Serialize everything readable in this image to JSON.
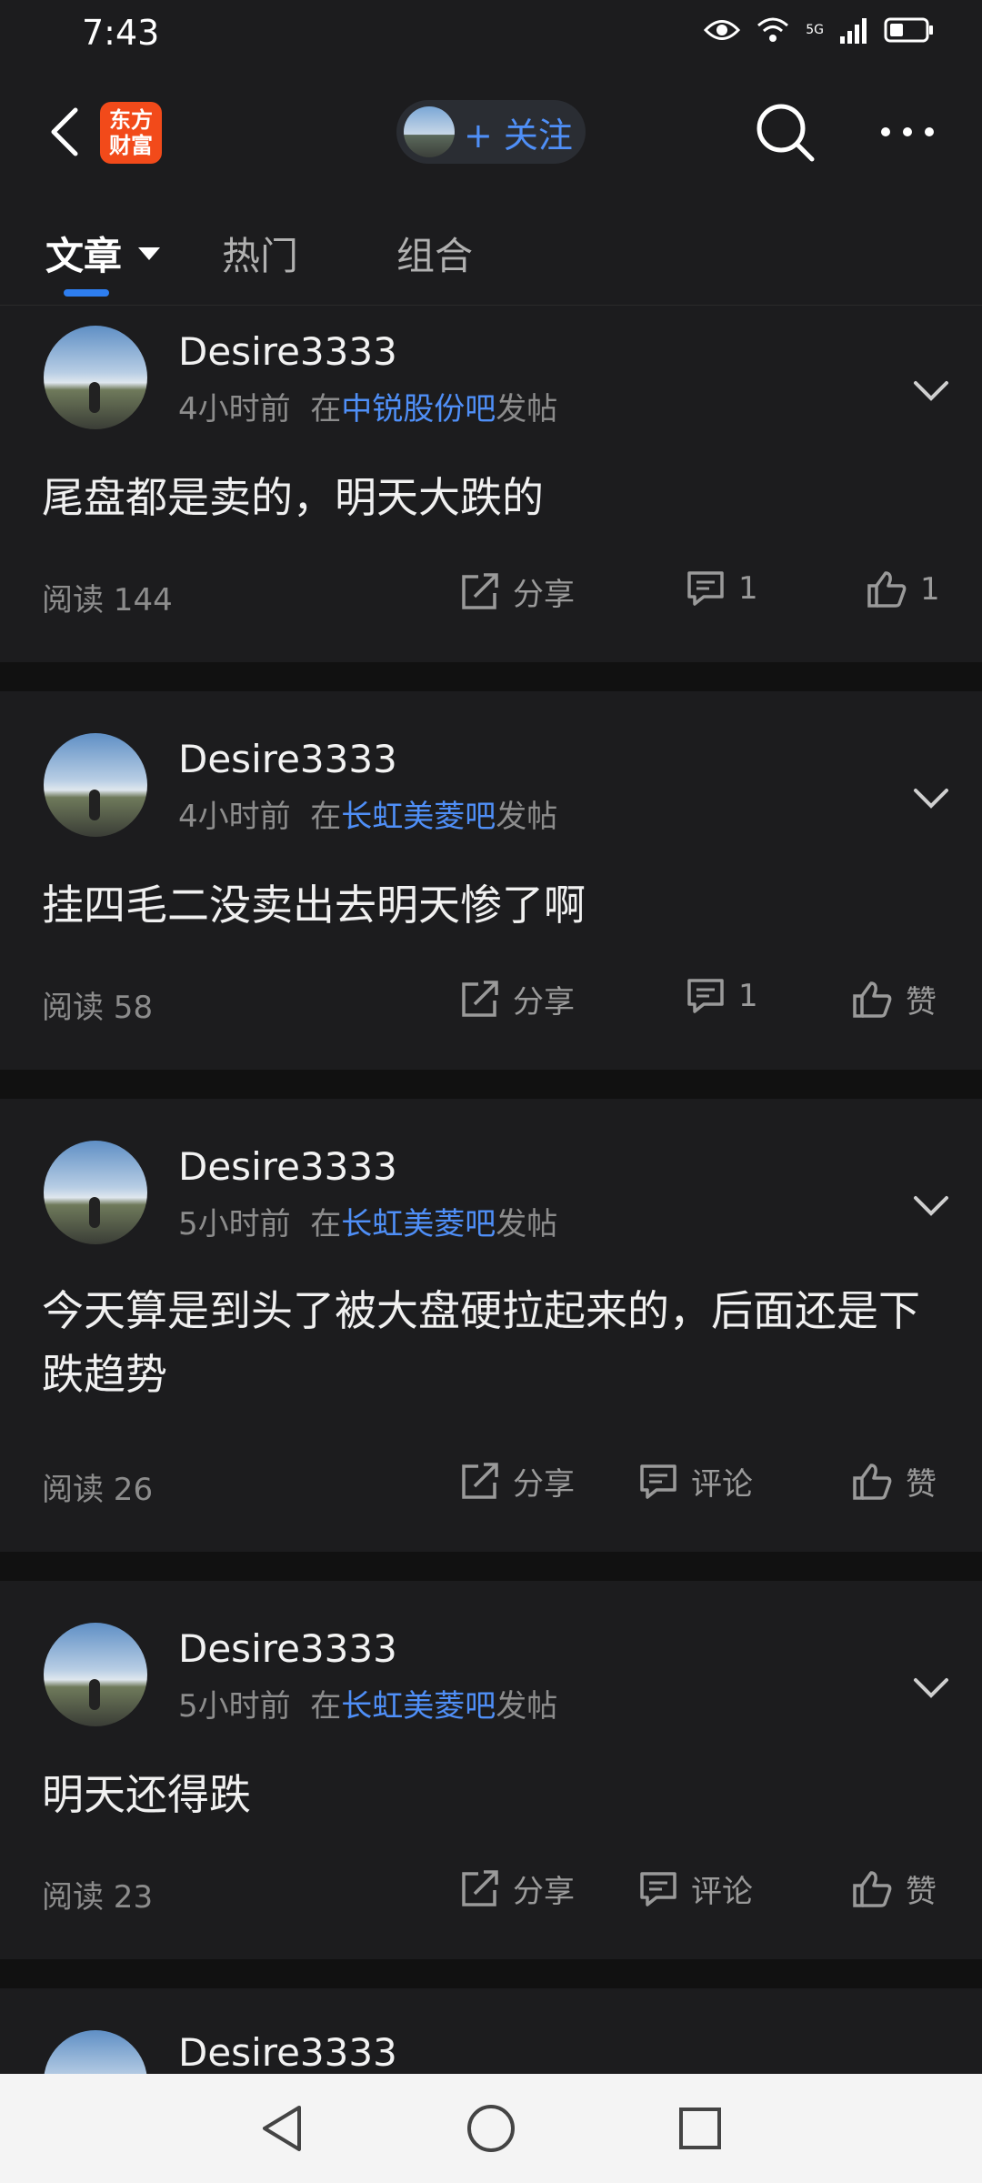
{
  "status": {
    "time": "7:43",
    "network": "5G"
  },
  "header": {
    "logo_line1": "东方",
    "logo_line2": "财富",
    "follow_label": "+ 关注"
  },
  "tabs": [
    {
      "label": "文章"
    },
    {
      "label": "热门"
    },
    {
      "label": "组合"
    }
  ],
  "posts": [
    {
      "username": "Desire3333",
      "time": "4小时前",
      "prefix": "在",
      "forum": "中锐股份吧",
      "suffix": "发帖",
      "text": "尾盘都是卖的，明天大跌的",
      "reads": "阅读 144",
      "share": "分享",
      "comments": "1",
      "likes": "1"
    },
    {
      "username": "Desire3333",
      "time": "4小时前",
      "prefix": "在",
      "forum": "长虹美菱吧",
      "suffix": "发帖",
      "text": "挂四毛二没卖出去明天惨了啊",
      "reads": "阅读 58",
      "share": "分享",
      "comments": "1",
      "likes": "赞"
    },
    {
      "username": "Desire3333",
      "time": "5小时前",
      "prefix": "在",
      "forum": "长虹美菱吧",
      "suffix": "发帖",
      "text": "今天算是到头了被大盘硬拉起来的，后面还是下跌趋势",
      "reads": "阅读 26",
      "share": "分享",
      "comments": "评论",
      "likes": "赞"
    },
    {
      "username": "Desire3333",
      "time": "5小时前",
      "prefix": "在",
      "forum": "长虹美菱吧",
      "suffix": "发帖",
      "text": "明天还得跌",
      "reads": "阅读 23",
      "share": "分享",
      "comments": "评论",
      "likes": "赞"
    },
    {
      "username": "Desire3333"
    }
  ],
  "colors": {
    "accent": "#4f8ff7",
    "tab_indicator": "#2e7ef0",
    "logo": "#f24a1a",
    "background": "#111111",
    "card": "#1c1c1e"
  }
}
